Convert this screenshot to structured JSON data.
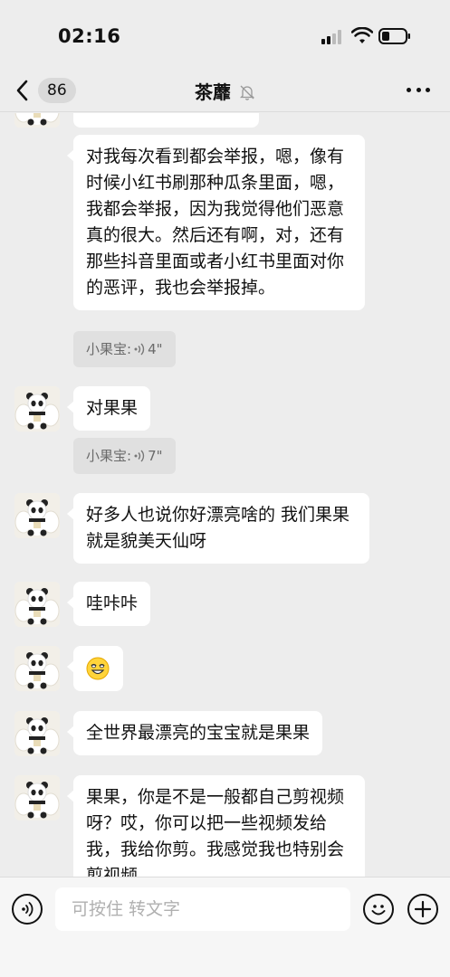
{
  "status_bar": {
    "time": "02:16"
  },
  "navbar": {
    "unread_count": "86",
    "title": "茶蘼"
  },
  "messages": [
    {
      "text": "对我每次看到都会举报，嗯，像有时候小红书刷那种瓜条里面，嗯，我都会举报，因为我觉得他们恶意真的很大。然后还有啊，对，还有那些抖音里面或者小红书里面对你的恶评，我也会举报掉。"
    },
    {
      "text": "对果果"
    },
    {
      "text": "好多人也说你好漂亮啥的 我们果果就是貌美天仙呀"
    },
    {
      "text": "哇咔咔"
    },
    {
      "text": "全世界最漂亮的宝宝就是果果"
    },
    {
      "text": "果果，你是不是一般都自己剪视频呀？哎，你可以把一些视频发给我，我给你剪。我感觉我也特别会剪视频"
    }
  ],
  "voice_tags": [
    {
      "sender": "小果宝:",
      "duration": "4\""
    },
    {
      "sender": "小果宝:",
      "duration": "7\""
    }
  ],
  "input": {
    "placeholder": "可按住 转文字"
  },
  "icons": {
    "back": "chevron-left-icon",
    "mute": "bell-off-icon",
    "more": "more-dots-icon",
    "voice": "voice-wave-icon",
    "emoji": "emoji-icon",
    "add": "plus-icon",
    "sticker": "grinning-face-icon"
  },
  "colors": {
    "background": "#ededed",
    "bubble": "#ffffff",
    "voice_tag": "#e0e0e0"
  }
}
